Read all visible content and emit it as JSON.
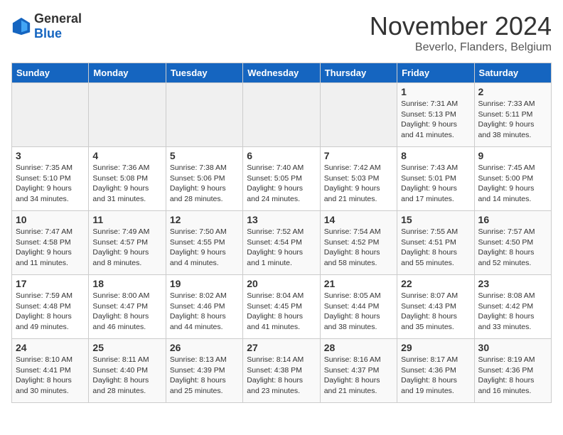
{
  "logo": {
    "text_general": "General",
    "text_blue": "Blue"
  },
  "title": {
    "month": "November 2024",
    "location": "Beverlo, Flanders, Belgium"
  },
  "headers": [
    "Sunday",
    "Monday",
    "Tuesday",
    "Wednesday",
    "Thursday",
    "Friday",
    "Saturday"
  ],
  "weeks": [
    [
      {
        "day": "",
        "empty": true
      },
      {
        "day": "",
        "empty": true
      },
      {
        "day": "",
        "empty": true
      },
      {
        "day": "",
        "empty": true
      },
      {
        "day": "",
        "empty": true
      },
      {
        "day": "1",
        "sunrise": "Sunrise: 7:31 AM",
        "sunset": "Sunset: 5:13 PM",
        "daylight": "Daylight: 9 hours and 41 minutes."
      },
      {
        "day": "2",
        "sunrise": "Sunrise: 7:33 AM",
        "sunset": "Sunset: 5:11 PM",
        "daylight": "Daylight: 9 hours and 38 minutes."
      }
    ],
    [
      {
        "day": "3",
        "sunrise": "Sunrise: 7:35 AM",
        "sunset": "Sunset: 5:10 PM",
        "daylight": "Daylight: 9 hours and 34 minutes."
      },
      {
        "day": "4",
        "sunrise": "Sunrise: 7:36 AM",
        "sunset": "Sunset: 5:08 PM",
        "daylight": "Daylight: 9 hours and 31 minutes."
      },
      {
        "day": "5",
        "sunrise": "Sunrise: 7:38 AM",
        "sunset": "Sunset: 5:06 PM",
        "daylight": "Daylight: 9 hours and 28 minutes."
      },
      {
        "day": "6",
        "sunrise": "Sunrise: 7:40 AM",
        "sunset": "Sunset: 5:05 PM",
        "daylight": "Daylight: 9 hours and 24 minutes."
      },
      {
        "day": "7",
        "sunrise": "Sunrise: 7:42 AM",
        "sunset": "Sunset: 5:03 PM",
        "daylight": "Daylight: 9 hours and 21 minutes."
      },
      {
        "day": "8",
        "sunrise": "Sunrise: 7:43 AM",
        "sunset": "Sunset: 5:01 PM",
        "daylight": "Daylight: 9 hours and 17 minutes."
      },
      {
        "day": "9",
        "sunrise": "Sunrise: 7:45 AM",
        "sunset": "Sunset: 5:00 PM",
        "daylight": "Daylight: 9 hours and 14 minutes."
      }
    ],
    [
      {
        "day": "10",
        "sunrise": "Sunrise: 7:47 AM",
        "sunset": "Sunset: 4:58 PM",
        "daylight": "Daylight: 9 hours and 11 minutes."
      },
      {
        "day": "11",
        "sunrise": "Sunrise: 7:49 AM",
        "sunset": "Sunset: 4:57 PM",
        "daylight": "Daylight: 9 hours and 8 minutes."
      },
      {
        "day": "12",
        "sunrise": "Sunrise: 7:50 AM",
        "sunset": "Sunset: 4:55 PM",
        "daylight": "Daylight: 9 hours and 4 minutes."
      },
      {
        "day": "13",
        "sunrise": "Sunrise: 7:52 AM",
        "sunset": "Sunset: 4:54 PM",
        "daylight": "Daylight: 9 hours and 1 minute."
      },
      {
        "day": "14",
        "sunrise": "Sunrise: 7:54 AM",
        "sunset": "Sunset: 4:52 PM",
        "daylight": "Daylight: 8 hours and 58 minutes."
      },
      {
        "day": "15",
        "sunrise": "Sunrise: 7:55 AM",
        "sunset": "Sunset: 4:51 PM",
        "daylight": "Daylight: 8 hours and 55 minutes."
      },
      {
        "day": "16",
        "sunrise": "Sunrise: 7:57 AM",
        "sunset": "Sunset: 4:50 PM",
        "daylight": "Daylight: 8 hours and 52 minutes."
      }
    ],
    [
      {
        "day": "17",
        "sunrise": "Sunrise: 7:59 AM",
        "sunset": "Sunset: 4:48 PM",
        "daylight": "Daylight: 8 hours and 49 minutes."
      },
      {
        "day": "18",
        "sunrise": "Sunrise: 8:00 AM",
        "sunset": "Sunset: 4:47 PM",
        "daylight": "Daylight: 8 hours and 46 minutes."
      },
      {
        "day": "19",
        "sunrise": "Sunrise: 8:02 AM",
        "sunset": "Sunset: 4:46 PM",
        "daylight": "Daylight: 8 hours and 44 minutes."
      },
      {
        "day": "20",
        "sunrise": "Sunrise: 8:04 AM",
        "sunset": "Sunset: 4:45 PM",
        "daylight": "Daylight: 8 hours and 41 minutes."
      },
      {
        "day": "21",
        "sunrise": "Sunrise: 8:05 AM",
        "sunset": "Sunset: 4:44 PM",
        "daylight": "Daylight: 8 hours and 38 minutes."
      },
      {
        "day": "22",
        "sunrise": "Sunrise: 8:07 AM",
        "sunset": "Sunset: 4:43 PM",
        "daylight": "Daylight: 8 hours and 35 minutes."
      },
      {
        "day": "23",
        "sunrise": "Sunrise: 8:08 AM",
        "sunset": "Sunset: 4:42 PM",
        "daylight": "Daylight: 8 hours and 33 minutes."
      }
    ],
    [
      {
        "day": "24",
        "sunrise": "Sunrise: 8:10 AM",
        "sunset": "Sunset: 4:41 PM",
        "daylight": "Daylight: 8 hours and 30 minutes."
      },
      {
        "day": "25",
        "sunrise": "Sunrise: 8:11 AM",
        "sunset": "Sunset: 4:40 PM",
        "daylight": "Daylight: 8 hours and 28 minutes."
      },
      {
        "day": "26",
        "sunrise": "Sunrise: 8:13 AM",
        "sunset": "Sunset: 4:39 PM",
        "daylight": "Daylight: 8 hours and 25 minutes."
      },
      {
        "day": "27",
        "sunrise": "Sunrise: 8:14 AM",
        "sunset": "Sunset: 4:38 PM",
        "daylight": "Daylight: 8 hours and 23 minutes."
      },
      {
        "day": "28",
        "sunrise": "Sunrise: 8:16 AM",
        "sunset": "Sunset: 4:37 PM",
        "daylight": "Daylight: 8 hours and 21 minutes."
      },
      {
        "day": "29",
        "sunrise": "Sunrise: 8:17 AM",
        "sunset": "Sunset: 4:36 PM",
        "daylight": "Daylight: 8 hours and 19 minutes."
      },
      {
        "day": "30",
        "sunrise": "Sunrise: 8:19 AM",
        "sunset": "Sunset: 4:36 PM",
        "daylight": "Daylight: 8 hours and 16 minutes."
      }
    ]
  ]
}
